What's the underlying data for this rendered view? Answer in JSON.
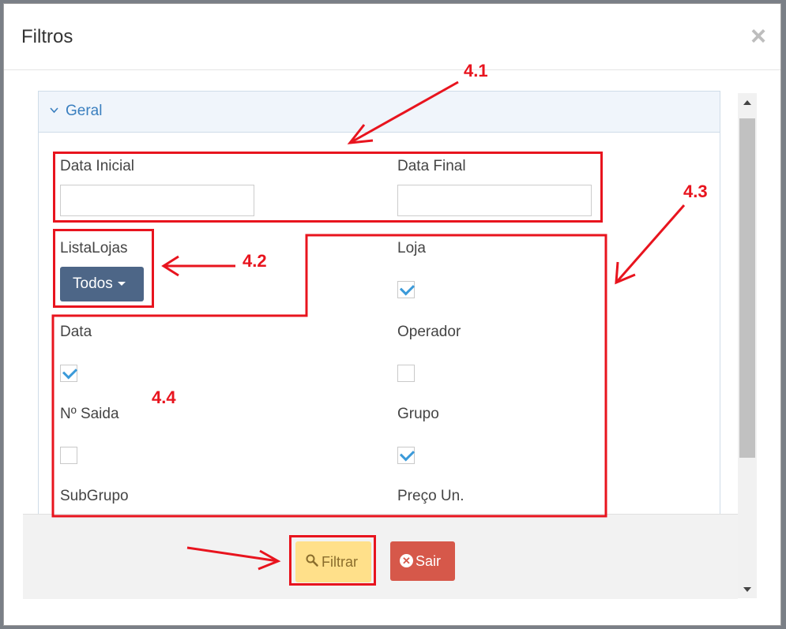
{
  "modal": {
    "title": "Filtros"
  },
  "panel": {
    "heading": "Geral"
  },
  "fields": {
    "data_inicial": {
      "label": "Data Inicial",
      "value": ""
    },
    "data_final": {
      "label": "Data Final",
      "value": ""
    },
    "lista_lojas": {
      "label": "ListaLojas",
      "selected": "Todos"
    }
  },
  "checkboxes": [
    {
      "label": "Loja",
      "checked": true
    },
    {
      "label": "Data",
      "checked": true
    },
    {
      "label": "Operador",
      "checked": false
    },
    {
      "label": "Nº Saida",
      "checked": false
    },
    {
      "label": "Grupo",
      "checked": true
    },
    {
      "label": "SubGrupo"
    },
    {
      "label": "Preço Un."
    }
  ],
  "buttons": {
    "filtrar": "Filtrar",
    "sair": "Sair"
  },
  "annotations": {
    "a1": "4.1",
    "a2": "4.2",
    "a3": "4.3",
    "a4": "4.4"
  },
  "colors": {
    "annotation": "#e8141e",
    "accent": "#3a7fbf"
  }
}
